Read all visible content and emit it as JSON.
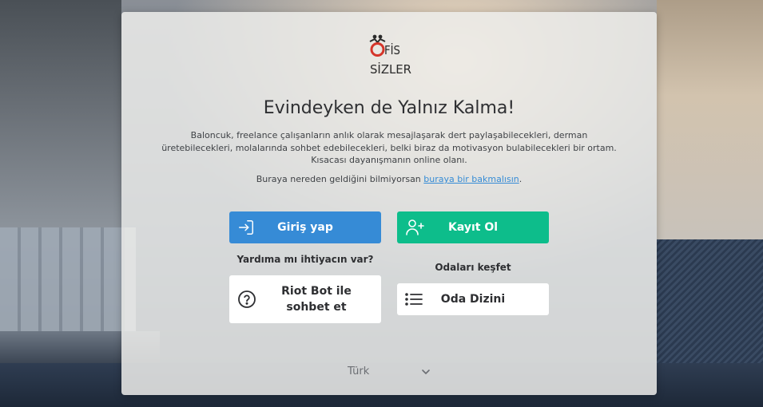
{
  "logo": {
    "line1": "OFİS",
    "line2": "SİZLER"
  },
  "title": "Evindeyken de Yalnız Kalma!",
  "description": "Baloncuk, freelance çalışanların anlık olarak mesajlaşarak dert paylaşabilecekleri, derman üretebilecekleri, molalarında sohbet edebilecekleri, belki biraz da motivasyon bulabilecekleri bir ortam. Kısacası dayanışmanın online olanı.",
  "where": {
    "prefix": "Buraya nereden geldiğini bilmiyorsan ",
    "link": "buraya bir bakmalısın",
    "suffix": "."
  },
  "buttons": {
    "login": "Giriş yap",
    "register": "Kayıt Ol",
    "bot": "Riot Bot ile sohbet et",
    "directory": "Oda Dizini"
  },
  "help_label": "Yardıma mı ihtiyacın var?",
  "explore_label": "Odaları keşfet",
  "language": {
    "selected": "Türk"
  },
  "colors": {
    "login": "#368bd6",
    "register": "#0dbd8b",
    "logo_red": "#d5352a",
    "logo_dark": "#2b2b2b"
  },
  "icons": {
    "login": "sign-in-icon",
    "register": "user-plus-icon",
    "bot": "question-circle-icon",
    "directory": "list-icon",
    "language": "chevron-down-icon"
  }
}
